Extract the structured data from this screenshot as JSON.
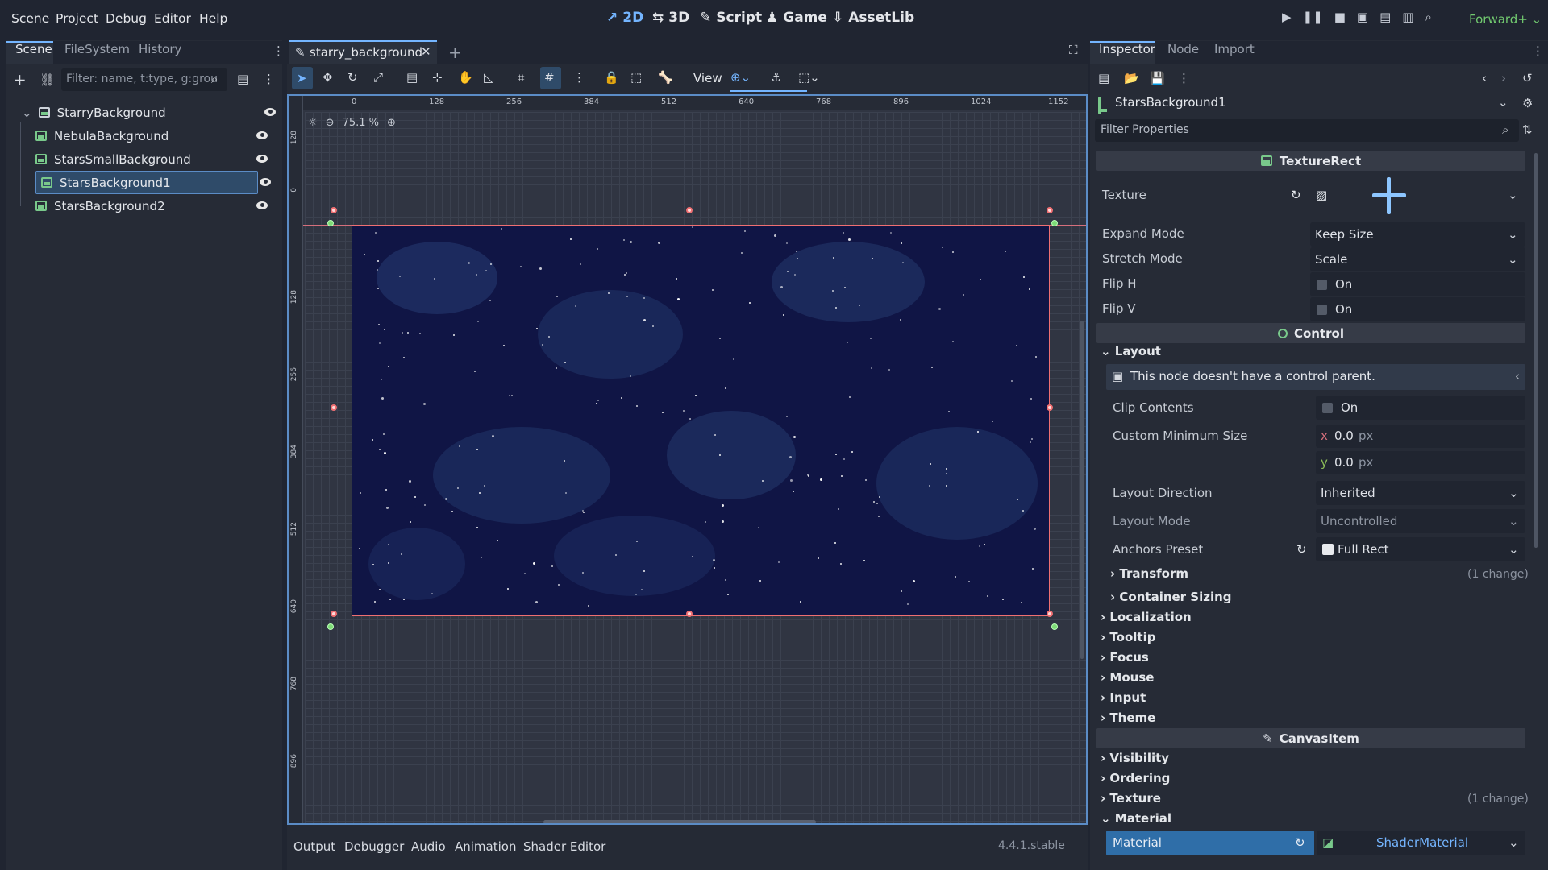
{
  "menu": {
    "items": [
      "Scene",
      "Project",
      "Debug",
      "Editor",
      "Help"
    ],
    "workspaces": [
      {
        "label": "2D",
        "icon": "2d-icon",
        "active": true
      },
      {
        "label": "3D",
        "icon": "3d-icon",
        "active": false
      },
      {
        "label": "Script",
        "icon": "script-icon",
        "active": false
      },
      {
        "label": "Game",
        "icon": "game-icon",
        "active": false
      },
      {
        "label": "AssetLib",
        "icon": "assetlib-icon",
        "active": false
      }
    ],
    "renderer": "Forward+"
  },
  "scene_dock": {
    "tabs": [
      "Scene",
      "FileSystem",
      "History"
    ],
    "filter_placeholder": "Filter: name, t:type, g:grou",
    "tree": [
      {
        "label": "StarryBackground",
        "icon": "node2d-icon"
      },
      {
        "label": "NebulaBackground",
        "icon": "texture-rect-icon"
      },
      {
        "label": "StarsSmallBackground",
        "icon": "texture-rect-icon"
      },
      {
        "label": "StarsBackground1",
        "icon": "texture-rect-icon",
        "selected": true
      },
      {
        "label": "StarsBackground2",
        "icon": "texture-rect-icon"
      }
    ]
  },
  "editor": {
    "scene_tab": "starry_background",
    "view_label": "View",
    "zoom": "75.1 %",
    "ruler_x": [
      "0",
      "128",
      "256",
      "384",
      "512",
      "640",
      "768",
      "896",
      "1024",
      "1152"
    ],
    "ruler_y": [
      "128",
      "0",
      "128",
      "256",
      "384",
      "512",
      "640",
      "768",
      "896"
    ]
  },
  "bottom_panel": {
    "tabs": [
      "Output",
      "Debugger",
      "Audio",
      "Animation",
      "Shader Editor"
    ],
    "version": "4.4.1.stable"
  },
  "inspector": {
    "tabs": [
      "Inspector",
      "Node",
      "Import"
    ],
    "selected_node": "StarsBackground1",
    "filter_placeholder": "Filter Properties",
    "sections": {
      "texture_rect": "TextureRect",
      "control": "Control",
      "canvas_item": "CanvasItem"
    },
    "texture_rect": {
      "texture_label": "Texture",
      "expand_mode_label": "Expand Mode",
      "expand_mode": "Keep Size",
      "stretch_mode_label": "Stretch Mode",
      "stretch_mode": "Scale",
      "flip_h_label": "Flip H",
      "flip_h_value": "On",
      "flip_v_label": "Flip V",
      "flip_v_value": "On"
    },
    "layout": {
      "group": "Layout",
      "warning": "This node doesn't have a control parent.",
      "clip_contents_label": "Clip Contents",
      "clip_contents_value": "On",
      "custom_min_size_label": "Custom Minimum Size",
      "min_x_axis": "x",
      "min_x": "0.0",
      "min_y_axis": "y",
      "min_y": "0.0",
      "unit": "px",
      "layout_direction_label": "Layout Direction",
      "layout_direction": "Inherited",
      "layout_mode_label": "Layout Mode",
      "layout_mode": "Uncontrolled",
      "anchors_preset_label": "Anchors Preset",
      "anchors_preset": "Full Rect",
      "transform": "Transform",
      "transform_changes": "(1 change)",
      "container_sizing": "Container Sizing"
    },
    "control_groups": [
      "Localization",
      "Tooltip",
      "Focus",
      "Mouse",
      "Input",
      "Theme"
    ],
    "canvas_groups": {
      "visibility": "Visibility",
      "ordering": "Ordering",
      "texture": "Texture",
      "texture_changes": "(1 change)",
      "material_group": "Material",
      "material_label": "Material",
      "material_value": "ShaderMaterial"
    }
  },
  "colors": {
    "accent": "#74b5ff",
    "selection": "#2f4b69",
    "sky": "#101545",
    "nebula": "#263d72",
    "handle": "#ef6f72",
    "renderer": "#71c96f"
  }
}
